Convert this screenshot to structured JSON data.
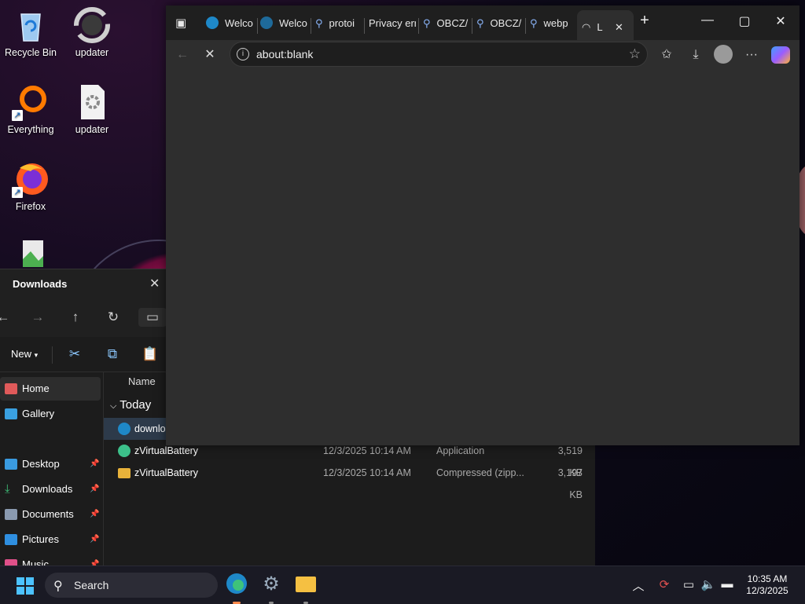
{
  "desktop": {
    "icons": [
      {
        "label": "Recycle Bin",
        "icon": "recycle-bin-icon"
      },
      {
        "label": "updater",
        "icon": "updater-sync-icon"
      },
      {
        "label": "Everything",
        "icon": "everything-app-icon"
      },
      {
        "label": "updater",
        "icon": "settings-file-icon"
      },
      {
        "label": "Firefox",
        "icon": "firefox-icon"
      }
    ]
  },
  "explorer": {
    "title": "Downloads",
    "command_bar": {
      "new_label": "New"
    },
    "sidebar": {
      "items": [
        {
          "label": "Home",
          "selected": true,
          "pinned": false
        },
        {
          "label": "Gallery",
          "pinned": false
        },
        {
          "label": "Desktop",
          "pinned": true
        },
        {
          "label": "Downloads",
          "pinned": true
        },
        {
          "label": "Documents",
          "pinned": true
        },
        {
          "label": "Pictures",
          "pinned": true
        },
        {
          "label": "Music",
          "pinned": true
        }
      ]
    },
    "columns": {
      "name": "Name"
    },
    "group": "Today",
    "rows": [
      {
        "name": "downlo",
        "date": "",
        "type": "",
        "size": "",
        "icon": "edge-file-icon",
        "selected": true
      },
      {
        "name": "zVirtualBattery",
        "date": "12/3/2025 10:14 AM",
        "type": "Application",
        "size": "3,519 KB",
        "icon": "application-icon"
      },
      {
        "name": "zVirtualBattery",
        "date": "12/3/2025 10:14 AM",
        "type": "Compressed (zipp...",
        "size": "3,197 KB",
        "icon": "zip-folder-icon"
      }
    ]
  },
  "browser": {
    "tabs": [
      {
        "label": "Welco",
        "icon": "edge-icon"
      },
      {
        "label": "Welco",
        "icon": "edge-icon"
      },
      {
        "label": "protoi",
        "icon": "search-icon"
      },
      {
        "label": "Privacy erro",
        "icon": "none"
      },
      {
        "label": "OBCZ/",
        "icon": "search-icon"
      },
      {
        "label": "OBCZ/",
        "icon": "search-icon"
      },
      {
        "label": "webp",
        "icon": "search-icon"
      },
      {
        "label": "L",
        "icon": "loading-spinner-icon",
        "active": true
      }
    ],
    "address": "about:blank",
    "page_background": "#2e2e2e"
  },
  "taskbar": {
    "search_label": "Search",
    "clock": {
      "time": "10:35 AM",
      "date": "12/3/2025"
    },
    "accent": "#4cc2ff"
  }
}
